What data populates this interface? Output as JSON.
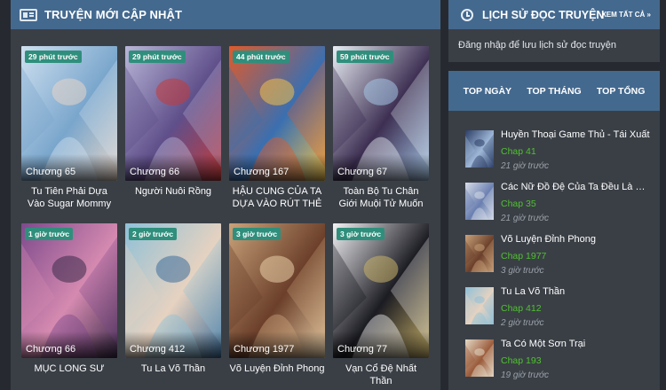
{
  "new_updates": {
    "title": "TRUYỆN MỚI CẬP NHẬT",
    "cards": [
      {
        "time": "29 phút trước",
        "chapter": "Chương 65",
        "title": "Tu Tiên Phải Dựa Vào Sugar Mommy",
        "colors": [
          "#cfe0f0",
          "#7aa6cc",
          "#e8d6c8"
        ]
      },
      {
        "time": "29 phút trước",
        "chapter": "Chương 66",
        "title": "Người Nuôi Rồng",
        "colors": [
          "#b9b6d8",
          "#5f4f8a",
          "#c43b3b"
        ]
      },
      {
        "time": "44 phút trước",
        "chapter": "Chương 167",
        "title": "HẬU CUNG CỦA TA DỰA VÀO RÚT THẺ",
        "colors": [
          "#e05a2a",
          "#3a6fb0",
          "#f2c14a"
        ]
      },
      {
        "time": "59 phút trước",
        "chapter": "Chương 67",
        "title": "Toàn Bộ Tu Chân Giới Muội Tử Muốn Bắt Ta",
        "colors": [
          "#e9eef5",
          "#3d2f52",
          "#a6c7e6"
        ]
      },
      {
        "time": "1 giờ trước",
        "chapter": "Chương 66",
        "title": "MỤC LONG SƯ",
        "colors": [
          "#7e4a8c",
          "#d58ab0",
          "#3b2a4a"
        ]
      },
      {
        "time": "2 giờ trước",
        "chapter": "Chương 412",
        "title": "Tu La Võ Thần",
        "colors": [
          "#8fc0d8",
          "#e6d2c0",
          "#3e6e9a"
        ]
      },
      {
        "time": "3 giờ trước",
        "chapter": "Chương 1977",
        "title": "Võ Luyện Đỉnh Phong",
        "colors": [
          "#c9a27a",
          "#6b3f2a",
          "#e9d0a8"
        ]
      },
      {
        "time": "3 giờ trước",
        "chapter": "Chương 77",
        "title": "Vạn Cổ Đệ Nhất Thần",
        "colors": [
          "#f2f2f5",
          "#1b1b22",
          "#c9b26a"
        ]
      }
    ]
  },
  "history": {
    "title": "LỊCH SỬ ĐỌC TRUYỆN",
    "view_all": "XEM TẤT CẢ »",
    "message": "Đăng nhập để lưu lịch sử đọc truyện"
  },
  "top": {
    "tabs": [
      "TOP NGÀY",
      "TOP THÁNG",
      "TOP TỔNG"
    ],
    "items": [
      {
        "name": "Huyền Thoại Game Thủ - Tái Xuất",
        "chap": "Chap 41",
        "time": "21 giờ trước",
        "colors": [
          "#2c3e66",
          "#9fb8d8"
        ]
      },
      {
        "name": "Các Nữ Đồ Đệ Của Ta Đều Là Chư...",
        "chap": "Chap 35",
        "time": "21 giờ trước",
        "colors": [
          "#d7dde8",
          "#6a7fb0"
        ]
      },
      {
        "name": "Võ Luyện Đỉnh Phong",
        "chap": "Chap 1977",
        "time": "3 giờ trước",
        "colors": [
          "#c9a27a",
          "#6b3f2a"
        ]
      },
      {
        "name": "Tu La Võ Thần",
        "chap": "Chap 412",
        "time": "2 giờ trước",
        "colors": [
          "#8fc0d8",
          "#e6d2c0"
        ]
      },
      {
        "name": "Ta Có Một Sơn Trại",
        "chap": "Chap 193",
        "time": "19 giờ trước",
        "colors": [
          "#e4d8c4",
          "#9a5a3a"
        ]
      }
    ]
  }
}
